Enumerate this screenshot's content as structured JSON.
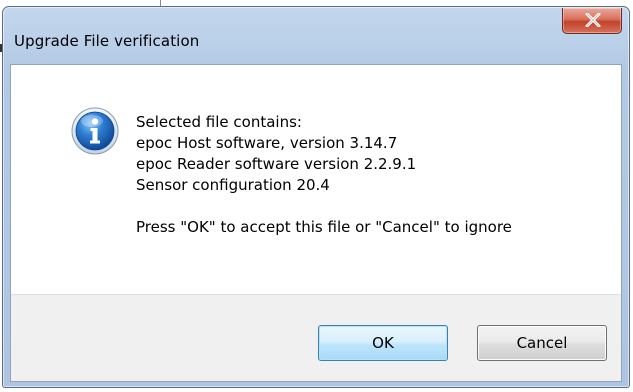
{
  "dialog": {
    "title": "Upgrade File verification",
    "close_symbol": "X",
    "icon": "information-icon",
    "message_lines": [
      "Selected file contains:",
      "epoc Host software, version 3.14.7",
      "epoc Reader software version 2.2.9.1",
      "Sensor configuration 20.4"
    ],
    "prompt": "Press \"OK\" to accept this file or \"Cancel\" to ignore",
    "buttons": {
      "ok_label": "OK",
      "cancel_label": "Cancel"
    }
  },
  "colors": {
    "frame": "#bcd1ea",
    "close_button": "#c2422a",
    "info_icon": "#1c63b7",
    "ok_button_border": "#3c7fb1",
    "footer": "#f0f0f0"
  }
}
